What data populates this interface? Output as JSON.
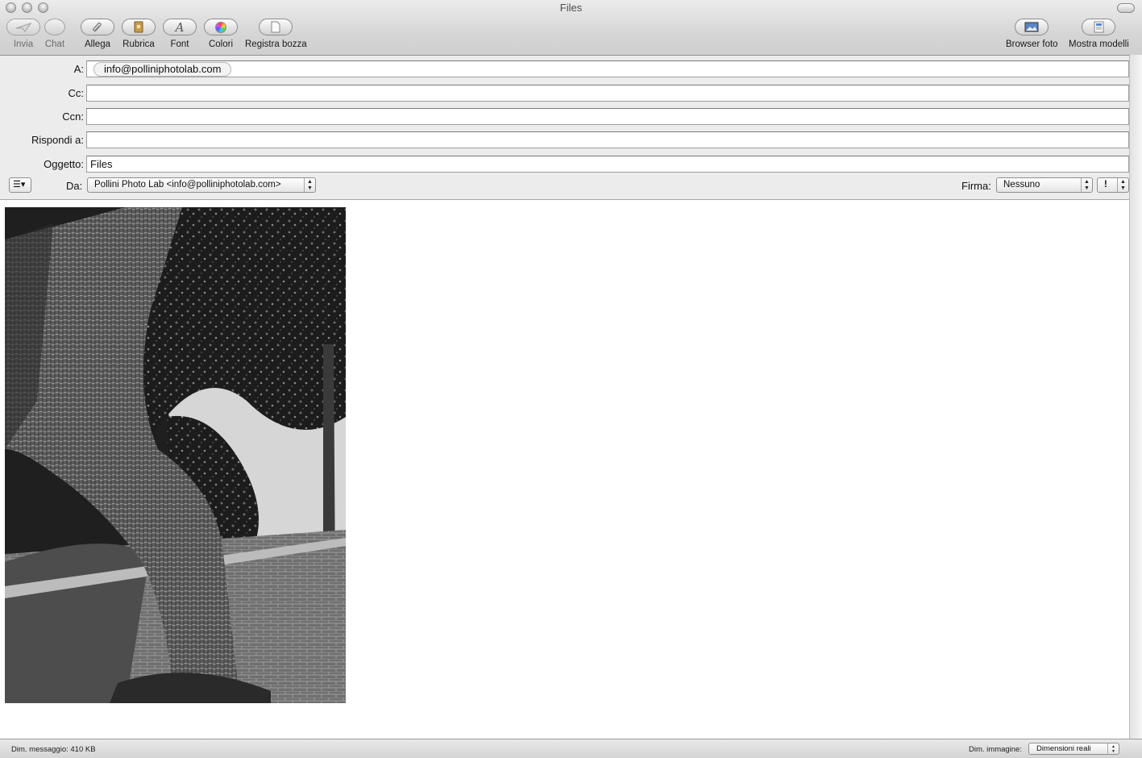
{
  "window": {
    "title": "Files"
  },
  "toolbar": {
    "left": [
      {
        "id": "send",
        "label": "Invia",
        "icon": "paper-plane-icon",
        "enabled": false
      },
      {
        "id": "chat",
        "label": "Chat",
        "icon": "chat-bubble-icon",
        "enabled": false
      },
      {
        "id": "attach",
        "label": "Allega",
        "icon": "paperclip-icon",
        "enabled": true
      },
      {
        "id": "addressbook",
        "label": "Rubrica",
        "icon": "address-book-icon",
        "enabled": true
      },
      {
        "id": "fonts",
        "label": "Font",
        "icon": "font-icon",
        "enabled": true
      },
      {
        "id": "colors",
        "label": "Colori",
        "icon": "color-wheel-icon",
        "enabled": true
      },
      {
        "id": "draft",
        "label": "Registra bozza",
        "icon": "document-icon",
        "enabled": true
      }
    ],
    "right": [
      {
        "id": "photo-browser",
        "label": "Browser foto",
        "icon": "photo-icon"
      },
      {
        "id": "stationery",
        "label": "Mostra modelli",
        "icon": "stationery-icon"
      }
    ]
  },
  "headers": {
    "to_label": "A:",
    "to_recipient": "info@polliniphotolab.com",
    "cc_label": "Cc:",
    "cc_value": "",
    "bcc_label": "Ccn:",
    "bcc_value": "",
    "reply_label": "Rispondi a:",
    "reply_value": "",
    "subject_label": "Oggetto:",
    "subject_value": "Files",
    "from_label": "Da:",
    "from_value": "Pollini Photo Lab <info@polliniphotolab.com>",
    "signature_label": "Firma:",
    "signature_value": "Nessuno",
    "priority_symbol": "!"
  },
  "body": {
    "attachment": {
      "type": "image",
      "icon": "photo-attachment"
    }
  },
  "status": {
    "message_size": "Dim. messaggio: 410 KB",
    "image_size_label": "Dim. immagine:",
    "image_size_value": "Dimensioni reali"
  }
}
